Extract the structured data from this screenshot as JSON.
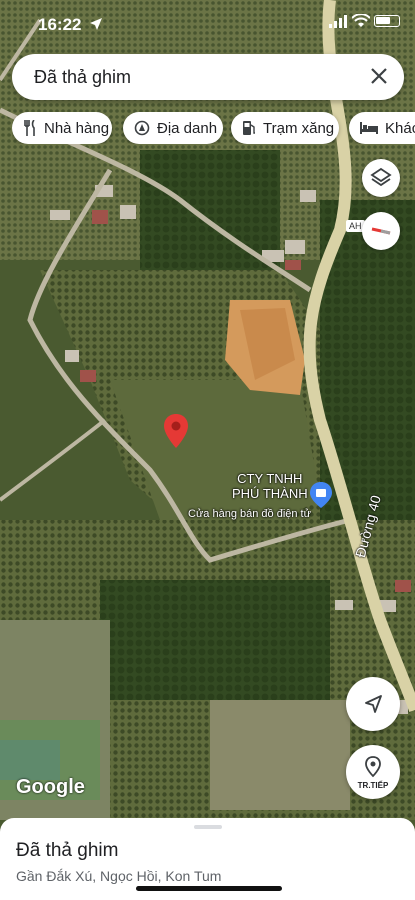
{
  "status_bar": {
    "time": "16:22"
  },
  "search": {
    "text": "Đã thả ghim"
  },
  "chips": [
    {
      "label": "Nhà hàng",
      "icon": "fork-knife-icon"
    },
    {
      "label": "Địa danh",
      "icon": "landmark-icon"
    },
    {
      "label": "Trạm xăng",
      "icon": "gas-station-icon"
    },
    {
      "label": "Khách",
      "icon": "bed-icon"
    }
  ],
  "map": {
    "road_badge": "AH",
    "business_name_line1": "CTY TNHH",
    "business_name_line2": "PHÚ THÀNH",
    "business_category": "Cửa hàng bán đồ điện tử",
    "road_name": "Đường 40",
    "attribution": "Google"
  },
  "controls": {
    "layers_icon": "layers-icon",
    "compass_icon": "compass-icon",
    "location_icon": "navigation-arrow-icon",
    "next_label": "TR.TIẾP"
  },
  "colors": {
    "pin": "#e53935",
    "business_marker": "#4285f4",
    "road": "#d9d2a6"
  },
  "bottom_sheet": {
    "title": "Đã thả ghim",
    "subtitle": "Gần Đắk Xú, Ngọc Hồi, Kon Tum"
  }
}
